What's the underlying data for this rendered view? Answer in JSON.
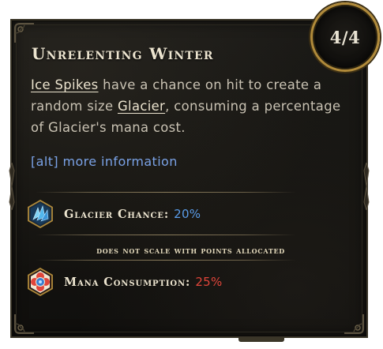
{
  "rank": {
    "current": "4",
    "separator": "/",
    "text": "4/4"
  },
  "title": "Unrelenting Winter",
  "description": {
    "link_ice_spikes": "Ice Spikes",
    "text_1": " have a chance on hit to create a random size ",
    "link_glacier": "Glacier",
    "text_2": ", consuming a percentage of Glacier's mana cost."
  },
  "alt_info": "[alt] more information",
  "stats": [
    {
      "icon": "glacier-crystal-icon",
      "label": "Glacier Chance:",
      "value": "20%",
      "value_color": "#5a9ce8"
    },
    {
      "icon": "mana-flower-icon",
      "label": "Mana Consumption:",
      "value": "25%",
      "value_color": "#e0453a"
    }
  ],
  "note": "does not scale with points allocated",
  "colors": {
    "frame_gold": "#b08a3a",
    "title": "#ece4cf",
    "body_text": "#c9c2b3",
    "alt_link": "#7aa2e6"
  }
}
